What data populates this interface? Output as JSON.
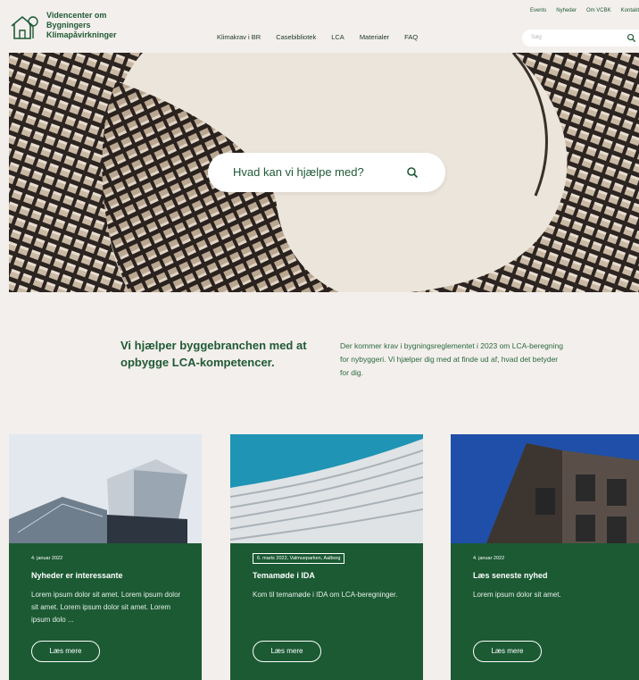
{
  "logo": {
    "line1": "Videncenter om",
    "line2": "Bygningers",
    "line3": "Klimapåvirkninger",
    "icon": "house-tree-icon"
  },
  "topnav": [
    "Events",
    "Nyheder",
    "Om VCBK",
    "Kontakt"
  ],
  "mainnav": [
    "Klimakrav i BR",
    "Casebibliotek",
    "LCA",
    "Materialer",
    "FAQ"
  ],
  "search_small": {
    "placeholder": "Søg",
    "icon": "search-icon"
  },
  "hero": {
    "search_text": "Hvad kan vi hjælpe med?",
    "icon": "search-icon"
  },
  "intro": {
    "heading": "Vi hjælper byggebranchen med at opbygge LCA-kompetencer.",
    "body": "Der kommer krav i bygningsreglementet i 2023 om LCA-beregning for nybyggeri. Vi hjælper dig med at finde ud af, hvad det betyder for dig."
  },
  "cards": [
    {
      "date": "4. januar 2022",
      "title": "Nyheder er interessante",
      "desc": "Lorem ipsum dolor sit amet. Lorem ipsum dolor sit amet. Lorem ipsum dolor sit amet. Lorem ipsum dolo ...",
      "button": "Læs mere"
    },
    {
      "date": "6. marts 2022, Valmueparken, Aalborg",
      "title": "Temamøde i IDA",
      "desc": "Kom til temamøde i IDA om LCA-beregninger.",
      "button": "Læs mere"
    },
    {
      "date": "4. januar 2022",
      "title": "Læs seneste nyhed",
      "desc": "Lorem ipsum dolor sit amet.",
      "button": "Læs mere"
    }
  ],
  "colors": {
    "brand_green": "#1b5a33",
    "background": "#f3efec"
  }
}
